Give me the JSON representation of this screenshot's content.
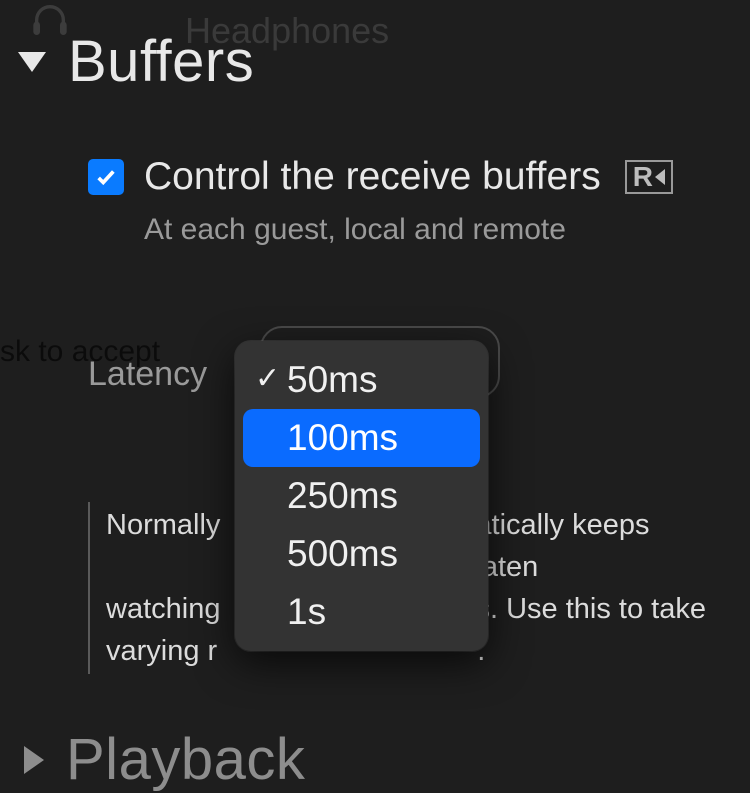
{
  "faded": {
    "headphones_label": "Headphones"
  },
  "bg": {
    "ask_to_accept": "sk to accept"
  },
  "sections": {
    "buffers": {
      "title": "Buffers",
      "checkbox_label": "Control the receive buffers",
      "r_badge": "R",
      "subtext": "At each guest, local and remote",
      "latency_label": "Latency",
      "desc_line1": "Normally",
      "desc_line1_right": "atically keeps laten",
      "desc_line2": "watching",
      "desc_line2_right": "s. Use this to take ",
      "desc_line3": "varying r",
      "desc_line3_right": "."
    },
    "playback": {
      "title": "Playback"
    }
  },
  "dropdown": {
    "options": [
      "50ms",
      "100ms",
      "250ms",
      "500ms",
      "1s"
    ],
    "selected_index": 0,
    "highlighted_index": 1
  }
}
